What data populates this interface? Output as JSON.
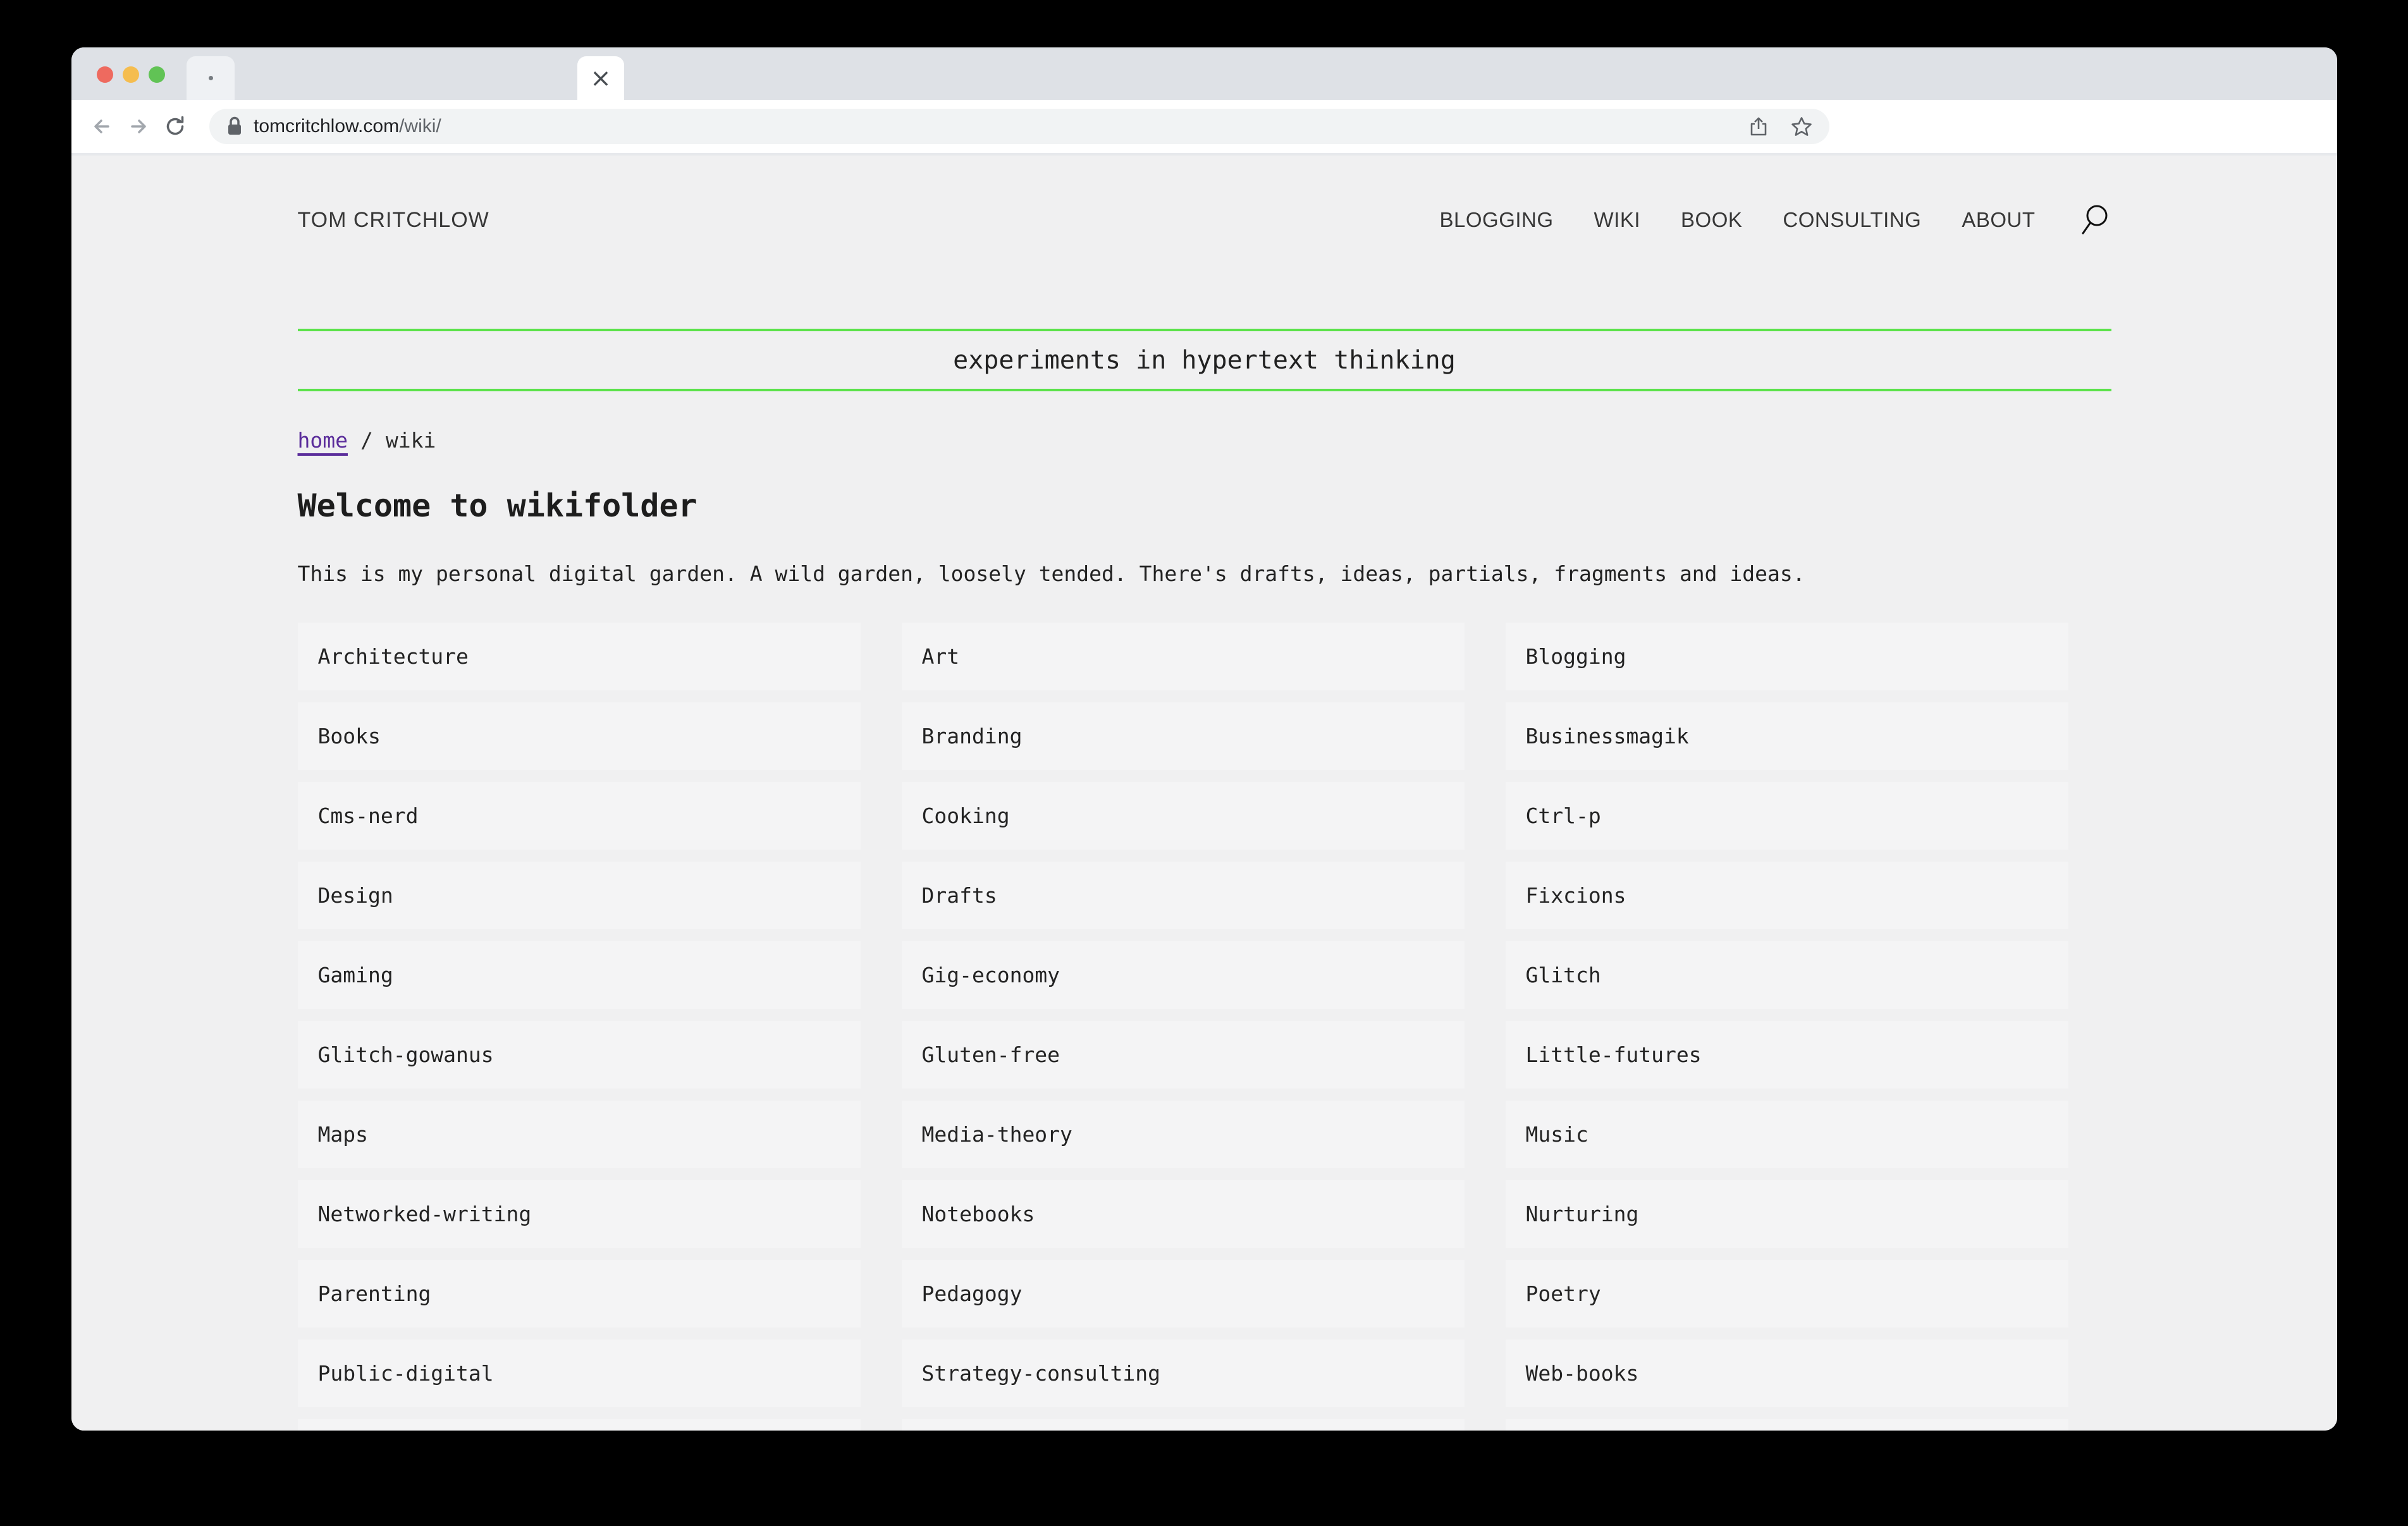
{
  "browser": {
    "url": {
      "domain": "tomcritchlow.com",
      "path": "/wiki/"
    },
    "tabs": {
      "active_close_glyph": "×"
    },
    "icons": {
      "back": "back-arrow",
      "forward": "forward-arrow",
      "reload": "reload",
      "lock": "padlock",
      "share": "share-up-arrow",
      "bookmark": "star-outline",
      "inactive_tab_favicon": "dot"
    }
  },
  "site": {
    "logo": "TOM CRITCHLOW",
    "nav": [
      "BLOGGING",
      "WIKI",
      "BOOK",
      "CONSULTING",
      "ABOUT"
    ],
    "search_icon": "magnifier",
    "banner": "experiments in hypertext thinking",
    "breadcrumb": {
      "home_link": "home",
      "separator": "/",
      "current": "wiki"
    },
    "heading": "Welcome to wikifolder",
    "intro": "This is my personal digital garden. A wild garden, loosely tended. There's drafts, ideas, partials, fragments and ideas.",
    "folders": [
      "Architecture",
      "Art",
      "Blogging",
      "Books",
      "Branding",
      "Businessmagik",
      "Cms-nerd",
      "Cooking",
      "Ctrl-p",
      "Design",
      "Drafts",
      "Fixcions",
      "Gaming",
      "Gig-economy",
      "Glitch",
      "Glitch-gowanus",
      "Gluten-free",
      "Little-futures",
      "Maps",
      "Media-theory",
      "Music",
      "Networked-writing",
      "Notebooks",
      "Nurturing",
      "Parenting",
      "Pedagogy",
      "Poetry",
      "Public-digital",
      "Strategy-consulting",
      "Web-books"
    ]
  },
  "colors": {
    "accent_green": "#5ce24b",
    "link_purple": "#5b2d9b",
    "traffic_red": "#ee6a5f",
    "traffic_yellow": "#f5bd4f",
    "traffic_green": "#61c355"
  }
}
